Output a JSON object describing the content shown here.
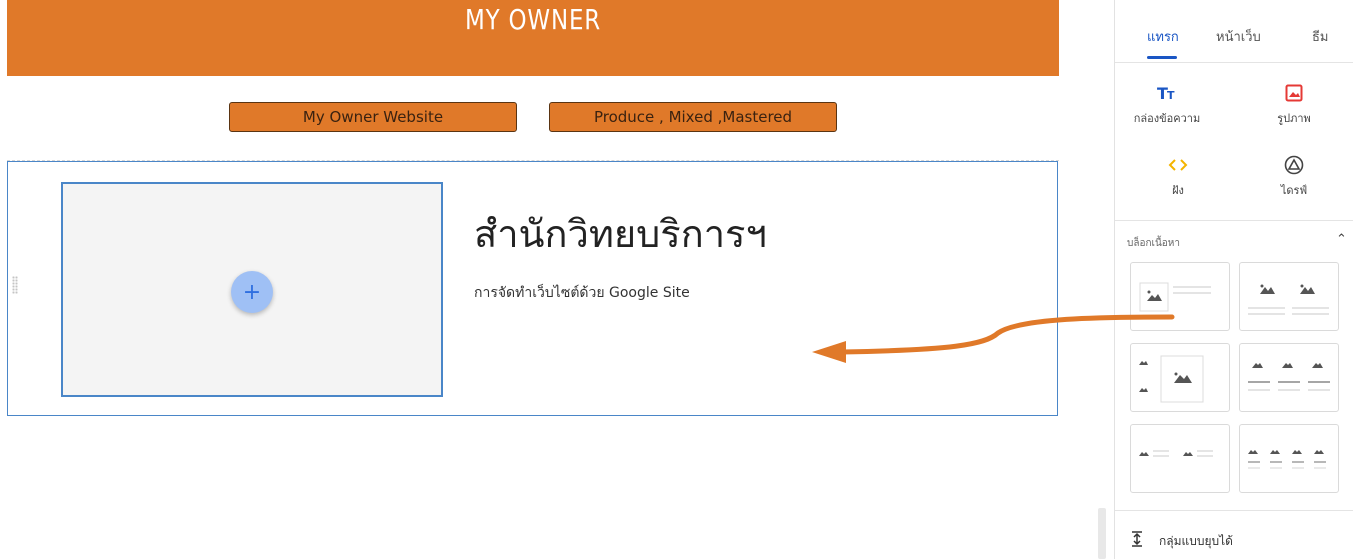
{
  "site": {
    "title": "MY OWNER",
    "nav": [
      "My Owner Website",
      "Produce , Mixed ,Mastered"
    ]
  },
  "section": {
    "heading": "สำนักวิทยบริการฯ",
    "subtext": "การจัดทำเว็บไซต์ด้วย Google Site",
    "add_symbol": "+"
  },
  "panel": {
    "tabs": [
      {
        "label": "แทรก",
        "active": true
      },
      {
        "label": "หน้าเว็บ",
        "active": false
      },
      {
        "label": "ธีม",
        "active": false
      }
    ],
    "tools": [
      {
        "label": "กล่องข้อความ",
        "icon": "text-box-icon",
        "color": "#1a56c4"
      },
      {
        "label": "รูปภาพ",
        "icon": "image-icon",
        "color": "#e53935"
      },
      {
        "label": "ฝัง",
        "icon": "embed-icon",
        "color": "#f4b400"
      },
      {
        "label": "ไดรฟ์",
        "icon": "drive-icon",
        "color": "#444444"
      }
    ],
    "blocks_title": "บล็อกเนื้อหา",
    "collapsible_label": "กลุ่มแบบยุบได้"
  },
  "colors": {
    "accent": "#e07929",
    "selection": "#4a86c8",
    "active_tab": "#1a56c4"
  }
}
